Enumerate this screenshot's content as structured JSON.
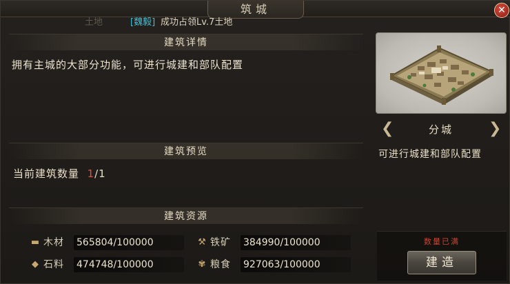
{
  "window": {
    "title": "筑城",
    "close_symbol": "✕"
  },
  "notice": {
    "faded_text": "土地",
    "tag": "[魏毅]",
    "message": "成功占领Lv.7土地"
  },
  "details": {
    "header": "建筑详情",
    "description": "拥有主城的大部分功能，可进行城建和部队配置"
  },
  "preview_section": {
    "header": "建筑预览",
    "count_label": "当前建筑数量",
    "count_current": "1",
    "count_max": "/1"
  },
  "resources": {
    "header": "建筑资源",
    "items": [
      {
        "icon": "wood-icon",
        "glyph": "▬",
        "name": "木材",
        "value": "565804/100000"
      },
      {
        "icon": "iron-icon",
        "glyph": "⚒",
        "name": "铁矿",
        "value": "384990/100000"
      },
      {
        "icon": "stone-icon",
        "glyph": "◆",
        "name": "石料",
        "value": "474748/100000"
      },
      {
        "icon": "grain-icon",
        "glyph": "✾",
        "name": "粮食",
        "value": "927063/100000"
      }
    ]
  },
  "building": {
    "name": "分城",
    "description": "可进行城建和部队配置",
    "prev_arrow": "❮",
    "next_arrow": "❯",
    "limit_notice": "数量已满",
    "build_label": "建造"
  }
}
